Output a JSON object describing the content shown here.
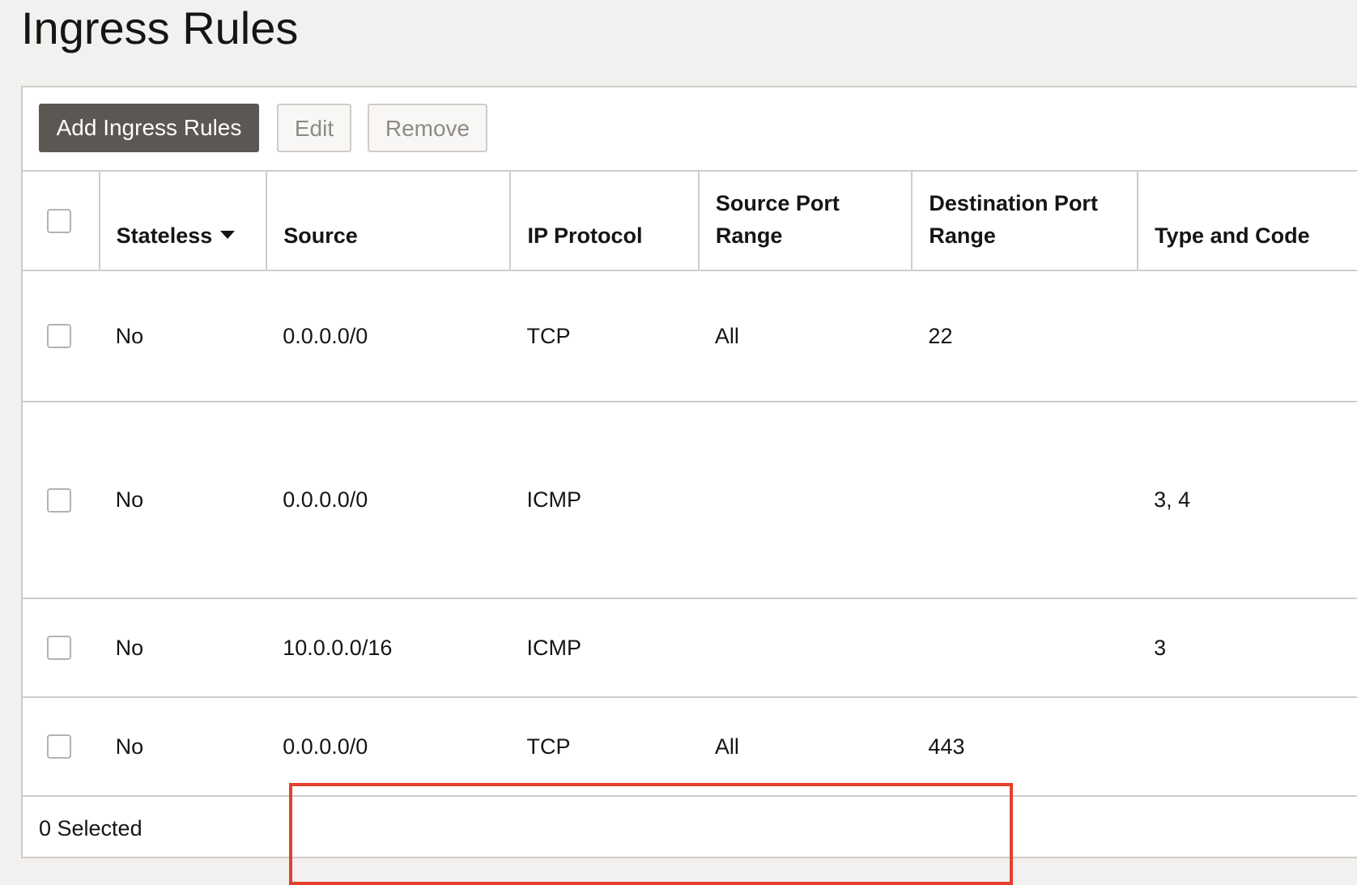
{
  "page": {
    "title": "Ingress Rules"
  },
  "toolbar": {
    "add_label": "Add Ingress Rules",
    "edit_label": "Edit",
    "remove_label": "Remove"
  },
  "table": {
    "columns": {
      "stateless": "Stateless",
      "source": "Source",
      "ip_protocol": "IP Protocol",
      "source_port_range": "Source Port Range",
      "destination_port_range": "Destination Port Range",
      "type_and_code": "Type and Code"
    },
    "sort_icon": "caret-down-icon",
    "rows": [
      {
        "stateless": "No",
        "source": "0.0.0.0/0",
        "ip_protocol": "TCP",
        "source_port_range": "All",
        "destination_port_range": "22",
        "type_and_code": ""
      },
      {
        "stateless": "No",
        "source": "0.0.0.0/0",
        "ip_protocol": "ICMP",
        "source_port_range": "",
        "destination_port_range": "",
        "type_and_code": "3, 4"
      },
      {
        "stateless": "No",
        "source": "10.0.0.0/16",
        "ip_protocol": "ICMP",
        "source_port_range": "",
        "destination_port_range": "",
        "type_and_code": "3"
      },
      {
        "stateless": "No",
        "source": "0.0.0.0/0",
        "ip_protocol": "TCP",
        "source_port_range": "All",
        "destination_port_range": "443",
        "type_and_code": ""
      }
    ]
  },
  "footer": {
    "selected_count": "0 Selected"
  },
  "colors": {
    "primary_button": "#5b5752",
    "highlight": "#e2412e",
    "border": "#cfcdca"
  }
}
